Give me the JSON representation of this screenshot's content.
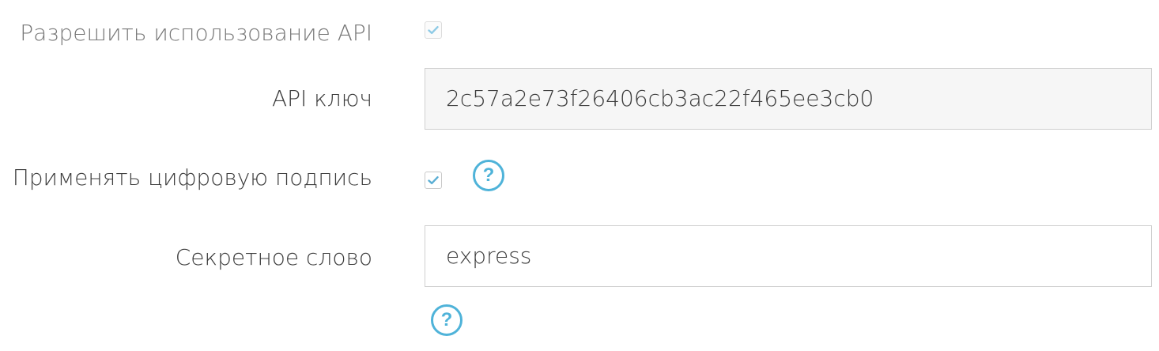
{
  "api": {
    "allow_label": "Разрешить использование API",
    "allow_checked": true,
    "key_label": "API ключ",
    "key_value": "2c57a2e73f26406cb3ac22f465ee3cb0",
    "signature_label": "Применять цифровую подпись",
    "signature_checked": true,
    "secret_label": "Секретное слово",
    "secret_value": "express",
    "help_glyph": "?"
  },
  "icons": {
    "checkbox_mark": "checkmark-icon",
    "help": "question-circle-icon"
  },
  "colors": {
    "accent": "#4fb3d9",
    "label_text": "#3d3d3d",
    "muted_label_text": "#777777",
    "field_border": "#cfcfcf",
    "readonly_bg": "#f6f6f6"
  }
}
